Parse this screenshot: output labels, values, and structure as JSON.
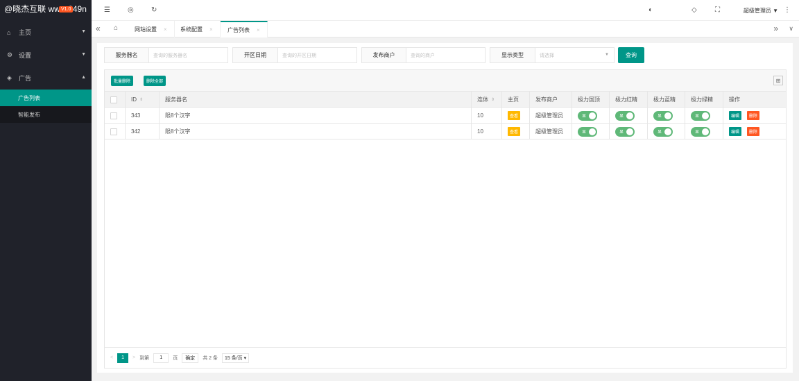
{
  "brand": {
    "watermark": "@晓杰互联 www.649n",
    "version": "V1.0"
  },
  "sidebar": {
    "items": [
      {
        "label": "主页",
        "icon": "home-icon",
        "arrow": "▼"
      },
      {
        "label": "设置",
        "icon": "gear-icon",
        "arrow": "▼"
      },
      {
        "label": "广告",
        "icon": "diamond-icon",
        "arrow": "▲"
      }
    ],
    "sub_items": [
      {
        "label": "广告列表",
        "active": true
      },
      {
        "label": "智能发布",
        "active": false
      }
    ]
  },
  "header": {
    "user": "超级管理员 ▼"
  },
  "tabs": [
    {
      "label": "网站设置"
    },
    {
      "label": "系统配置"
    },
    {
      "label": "广告列表",
      "active": true
    }
  ],
  "search": {
    "fields": [
      {
        "label": "服务器名",
        "placeholder": "查询的服务器名"
      },
      {
        "label": "开区日期",
        "placeholder": "查询的开区日期"
      },
      {
        "label": "发布商户",
        "placeholder": "查询的商户"
      },
      {
        "label": "显示类型",
        "placeholder": "请选择"
      }
    ],
    "button": "查询"
  },
  "toolbar": {
    "batch_delete": "批量删除",
    "delete_all": "删除全部"
  },
  "table": {
    "headers": [
      "ID",
      "服务器名",
      "连体",
      "主页",
      "发布商户",
      "极力国顶",
      "极力红精",
      "极力蓝精",
      "极力绿精",
      "操作"
    ],
    "rows": [
      {
        "id": "343",
        "name": "限8个汉字",
        "lianti": "10",
        "home": "查看",
        "merchant": "超级管理员",
        "s1": "显",
        "s2": "显",
        "s3": "显",
        "s4": "显",
        "edit": "编辑",
        "del": "删除"
      },
      {
        "id": "342",
        "name": "限8个汉字",
        "lianti": "10",
        "home": "查看",
        "merchant": "超级管理员",
        "s1": "显",
        "s2": "显",
        "s3": "显",
        "s4": "显",
        "edit": "编辑",
        "del": "删除"
      }
    ]
  },
  "pager": {
    "prev": "<",
    "current": "1",
    "next": ">",
    "goto": "到第",
    "page_input": "1",
    "page_unit": "页",
    "confirm": "确定",
    "total": "共 2 条",
    "per_page": "15 条/页"
  }
}
